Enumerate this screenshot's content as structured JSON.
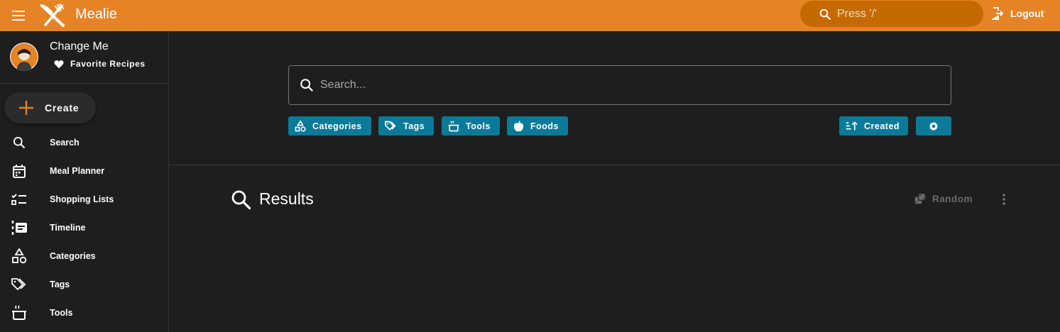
{
  "app": {
    "title": "Mealie"
  },
  "topbar": {
    "search_placeholder": "Press '/'",
    "logout_label": "Logout"
  },
  "user": {
    "name": "Change Me",
    "favorites_label": "Favorite Recipes"
  },
  "sidebar": {
    "create_label": "Create",
    "items": [
      {
        "label": "Search",
        "icon": "search-icon"
      },
      {
        "label": "Meal Planner",
        "icon": "calendar-icon"
      },
      {
        "label": "Shopping Lists",
        "icon": "checklist-icon"
      },
      {
        "label": "Timeline",
        "icon": "timeline-icon"
      },
      {
        "label": "Categories",
        "icon": "shapes-icon"
      },
      {
        "label": "Tags",
        "icon": "tags-icon"
      },
      {
        "label": "Tools",
        "icon": "pot-icon"
      }
    ]
  },
  "search": {
    "placeholder": "Search...",
    "filters": [
      {
        "label": "Categories",
        "icon": "shapes-icon"
      },
      {
        "label": "Tags",
        "icon": "tags-icon"
      },
      {
        "label": "Tools",
        "icon": "pot-icon"
      },
      {
        "label": "Foods",
        "icon": "apple-icon"
      }
    ],
    "sort_label": "Created",
    "settings_icon": "gear-icon"
  },
  "results": {
    "title": "Results",
    "random_label": "Random"
  },
  "colors": {
    "accent": "#e58325",
    "chip": "#0a7a98",
    "background": "#1e1e1e"
  }
}
